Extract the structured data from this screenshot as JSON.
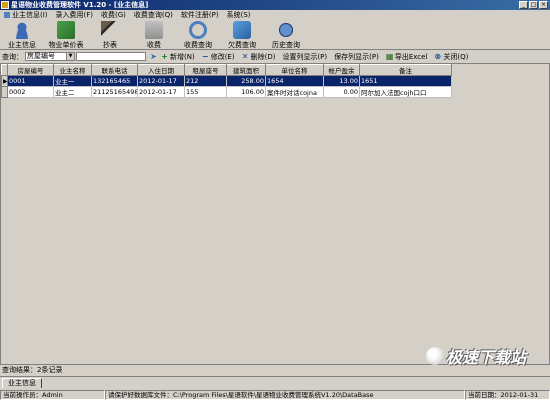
{
  "window": {
    "title": "星语物业收费管理软件 V1.20 - [业主信息]"
  },
  "menu": [
    "业主信息(I)",
    "录入费用(F)",
    "收费(G)",
    "收费查询(Q)",
    "软件注册(P)",
    "系统(S)"
  ],
  "toolbar": [
    {
      "label": "业主信息",
      "icon": "user-icon"
    },
    {
      "label": "物业单价表",
      "icon": "price-table-icon"
    },
    {
      "label": "抄表",
      "icon": "meter-icon"
    },
    {
      "label": "收费",
      "icon": "fee-icon"
    },
    {
      "label": "收费查询",
      "icon": "search-icon"
    },
    {
      "label": "欠费查询",
      "icon": "arrears-icon"
    },
    {
      "label": "历史查询",
      "icon": "history-icon"
    }
  ],
  "query": {
    "label": "查询：",
    "field": "房屋编号",
    "value": "",
    "actions": [
      {
        "label": "新增(N)",
        "icon": "plus-icon",
        "glyph": "+"
      },
      {
        "label": "修改(E)",
        "icon": "minus-icon",
        "glyph": "−"
      },
      {
        "label": "删除(D)",
        "icon": "delete-icon",
        "glyph": "✕"
      },
      {
        "label": "设置列显示(P)",
        "icon": "",
        "glyph": ""
      },
      {
        "label": "保存列显示(P)",
        "icon": "",
        "glyph": ""
      },
      {
        "label": "导出Excel",
        "icon": "excel-icon",
        "glyph": "▦"
      },
      {
        "label": "关闭(Q)",
        "icon": "close-icon",
        "glyph": "⊗"
      }
    ]
  },
  "table": {
    "columns": [
      "房屋编号",
      "业主名称",
      "联系电话",
      "入住日期",
      "租屋座号",
      "建筑面积",
      "单位名称",
      "帐户盈余",
      "备注"
    ],
    "rows": [
      [
        "0001",
        "业主一",
        "132165465",
        "2012-01-17",
        "212",
        "258.00",
        "1654",
        "13.00",
        "1651"
      ],
      [
        "0002",
        "业主二",
        "21125165498",
        "2012-01-17",
        "155",
        "106.00",
        "案件时对话cojna",
        "0.00",
        "阿尔加入法国cojh口口"
      ]
    ]
  },
  "status": {
    "result": "查询结果：2条记录",
    "tab": "业主信息",
    "operator": "当前操作员：Admin",
    "path": "请保护好数据库文件：C:\\Program Files\\星语软件\\星语物业收费管理系统V1.20\\DataBase",
    "date": "当前日期：2012-01-31"
  },
  "watermark": {
    "text": "极速下载站"
  }
}
